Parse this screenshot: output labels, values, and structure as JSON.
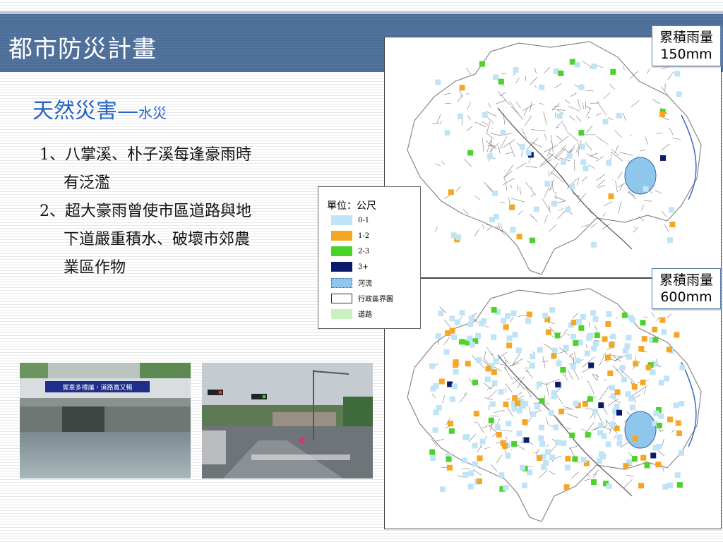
{
  "slide": {
    "title": "都市防災計畫",
    "subtitle_main": "天然災害—",
    "subtitle_sub": "水災",
    "points": [
      {
        "line1": "1、八掌溪、朴子溪每逢豪雨時",
        "line2": "有泛濫",
        "line3": ""
      },
      {
        "line1": "2、超大豪雨曾使市區道路與地",
        "line2": "下道嚴重積水、破壞市郊農",
        "line3": "業區作物"
      }
    ]
  },
  "maps": [
    {
      "label_line1": "累積雨量",
      "label_line2": "150mm"
    },
    {
      "label_line1": "累積雨量",
      "label_line2": "600mm"
    }
  ],
  "legend": {
    "title": "單位：公尺",
    "items": [
      {
        "label": "0-1",
        "color": "#bfe3f7"
      },
      {
        "label": "1-2",
        "color": "#f5a623"
      },
      {
        "label": "2-3",
        "color": "#4cd32a"
      },
      {
        "label": "3+",
        "color": "#0c1a6e"
      },
      {
        "label": "河流",
        "color": "#8fc6ec"
      },
      {
        "label": "行政區界圖",
        "color": "#ffffff"
      },
      {
        "label": "道路",
        "color": "#c9f1c0"
      }
    ]
  },
  "photo1_banner": "駕車多禮讓・道路寬又暢",
  "colors": {
    "title_bar": "#4d6e98",
    "subtitle": "#2464c8",
    "flood_0_1": "#bfe3f7",
    "flood_1_2": "#f5a623",
    "flood_2_3": "#4cd32a",
    "flood_3_plus": "#0c1a6e"
  },
  "icons": [
    "flood-depth-map",
    "underpass-flood-photo",
    "street-flood-photo"
  ]
}
